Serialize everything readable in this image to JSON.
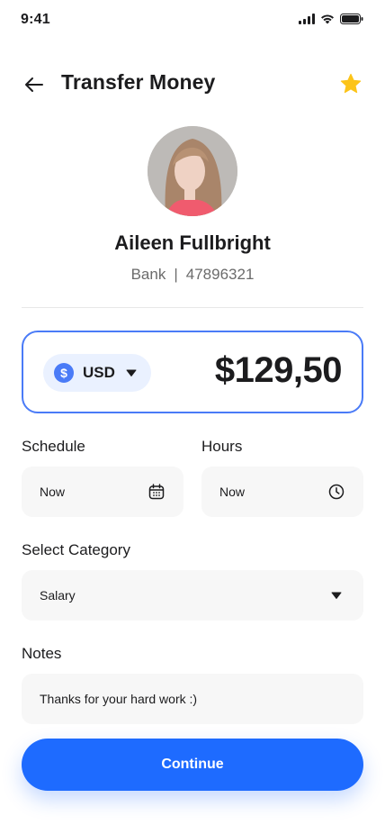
{
  "status": {
    "time": "9:41"
  },
  "header": {
    "title": "Transfer Money"
  },
  "recipient": {
    "name": "Aileen Fullbright",
    "bank": "Bank",
    "separator": "|",
    "account": "47896321"
  },
  "amount": {
    "currency_symbol": "$",
    "currency": "USD",
    "value": "$129,50"
  },
  "schedule": {
    "label": "Schedule",
    "value": "Now",
    "icon": "calendar-icon"
  },
  "hours": {
    "label": "Hours",
    "value": "Now",
    "icon": "clock-icon"
  },
  "category": {
    "label": "Select Category",
    "value": "Salary",
    "icon": "caret-down-icon"
  },
  "notes": {
    "label": "Notes",
    "value": "Thanks for your hard work :)"
  },
  "actions": {
    "continue_label": "Continue"
  },
  "colors": {
    "accent": "#1e6bff",
    "card_border": "#4a7bf7",
    "star": "#fcc419",
    "field_bg": "#f7f7f7"
  }
}
